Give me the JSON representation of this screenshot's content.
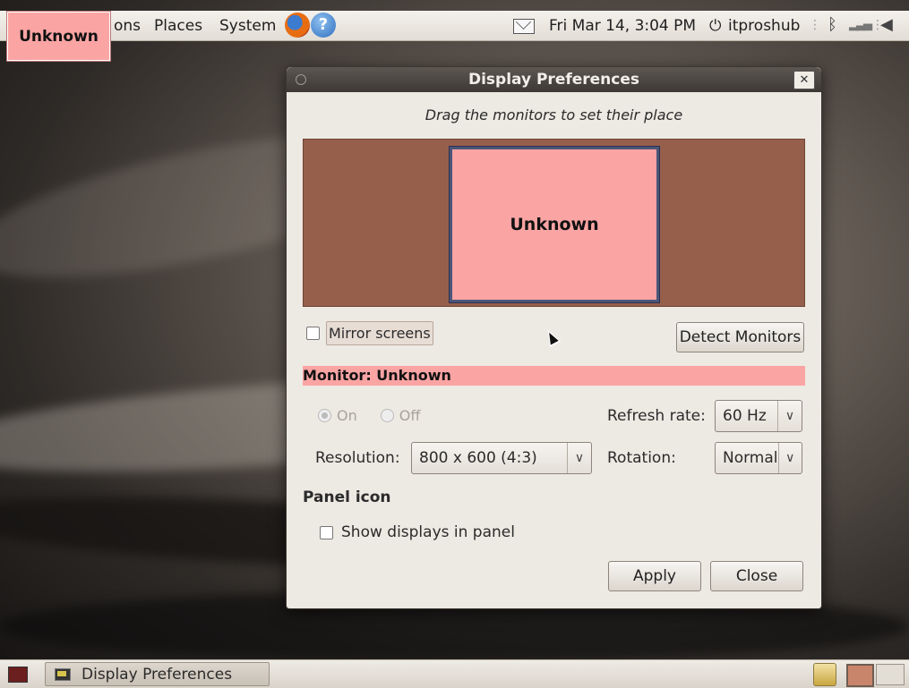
{
  "top_panel": {
    "menus": {
      "apps": "ons",
      "places": "Places",
      "system": "System"
    },
    "clock": "Fri Mar 14,  3:04 PM",
    "user": "itproshub",
    "help_glyph": "?"
  },
  "badge": {
    "label": "Unknown"
  },
  "dialog": {
    "title": "Display Preferences",
    "close_glyph": "✕",
    "drag_hint": "Drag the monitors to set their place",
    "monitor_name": "Unknown",
    "mirror_label": "Mirror screens",
    "detect_label": "Detect Monitors",
    "monitor_header": "Monitor: Unknown",
    "on_label": "On",
    "off_label": "Off",
    "refresh_label": "Refresh rate:",
    "refresh_value": "60 Hz",
    "resolution_label": "Resolution:",
    "resolution_value": "800 x 600 (4:3)",
    "rotation_label": "Rotation:",
    "rotation_value": "Normal",
    "panel_icon_title": "Panel icon",
    "show_displays_label": "Show displays in panel",
    "apply_label": "Apply",
    "close_label": "Close"
  },
  "bottom_panel": {
    "task_label": "Display Preferences"
  },
  "colors": {
    "monitor_area": "#965f4b",
    "monitor_fill": "#fba4a4",
    "titlebar": "#3d3834"
  }
}
